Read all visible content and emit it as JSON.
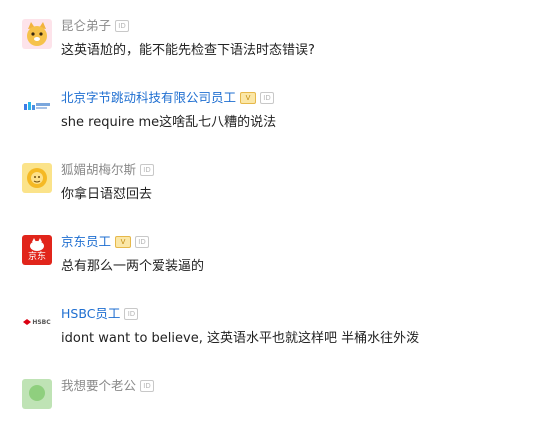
{
  "comments": [
    {
      "username": "昆仑弟子",
      "official": false,
      "verified": false,
      "id_badge": "ID",
      "text": "这英语尬的，能不能先检查下语法时态错误?",
      "avatar": "cat-face-icon"
    },
    {
      "username": "北京字节跳动科技有限公司员工",
      "official": true,
      "verified": true,
      "v_badge": "V",
      "id_badge": "ID",
      "text": "she require me这啥乱七八糟的说法",
      "avatar": "bytedance-logo-icon"
    },
    {
      "username": "狐媚胡梅尔斯",
      "official": false,
      "verified": false,
      "id_badge": "ID",
      "text": "你拿日语怼回去",
      "avatar": "yellow-face-icon"
    },
    {
      "username": "京东员工",
      "official": true,
      "verified": true,
      "v_badge": "V",
      "id_badge": "ID",
      "text": "总有那么一两个爱装逼的",
      "avatar": "jd-logo-icon",
      "avatar_label": "京东"
    },
    {
      "username": "HSBC员工",
      "official": true,
      "verified": false,
      "id_badge": "ID",
      "text": "idont want to believe, 这英语水平也就这样吧 半桶水往外泼",
      "avatar": "hsbc-logo-icon",
      "avatar_label": "HSBC"
    },
    {
      "username": "我想要个老公",
      "official": false,
      "verified": false,
      "id_badge": "ID",
      "text": "",
      "avatar": "green-avatar-icon"
    }
  ],
  "colors": {
    "official_name": "#1f6fd1",
    "normal_name": "#8a8a8a",
    "text": "#222222",
    "jd_red": "#e1251b"
  }
}
